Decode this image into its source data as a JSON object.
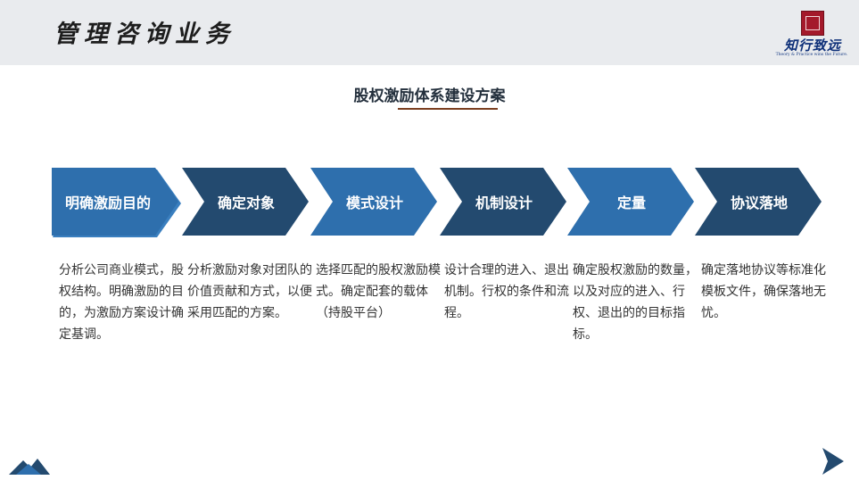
{
  "header": {
    "title": "管理咨询业务",
    "logo": {
      "text": "知行致远",
      "tagline": "Theory & Practice wins the Future."
    }
  },
  "section": {
    "title": "股权激励体系建设方案"
  },
  "steps": [
    {
      "label": "明确激励目的",
      "color": "#2e6fad"
    },
    {
      "label": "确定对象",
      "color": "#234a6f"
    },
    {
      "label": "模式设计",
      "color": "#2e6fad"
    },
    {
      "label": "机制设计",
      "color": "#234a6f"
    },
    {
      "label": "定量",
      "color": "#2e6fad"
    },
    {
      "label": "协议落地",
      "color": "#234a6f"
    }
  ],
  "descriptions": [
    "分析公司商业模式，股权结构。明确激励的目的，为激励方案设计确定基调。",
    "分析激励对象对团队的价值贡献和方式，以便采用匹配的方案。",
    "选择匹配的股权激励模式。确定配套的载体（持股平台）",
    "设计合理的进入、退出机制。行权的条件和流程。",
    "确定股权激励的数量，以及对应的进入、行权、退出的的目标指标。",
    "确定落地协议等标准化模板文件，确保落地无忧。"
  ],
  "nav": {
    "left_icon": "mountain-decor-icon",
    "right_icon": "next-slide-arrow-icon"
  }
}
